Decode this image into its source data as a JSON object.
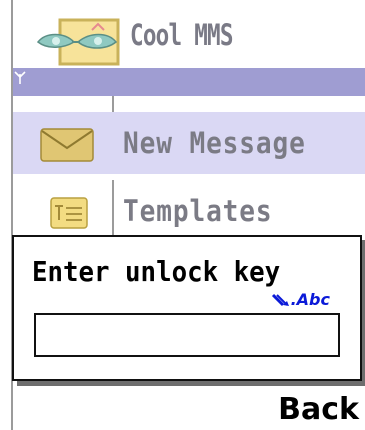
{
  "app": {
    "title": "Cool MMS",
    "icon": "app-logo-icon"
  },
  "status": {
    "signal_icon": "signal-antenna-icon"
  },
  "menu": {
    "items": [
      {
        "label": "New Message",
        "icon": "envelope-icon",
        "selected": true
      },
      {
        "label": "Templates",
        "icon": "template-icon",
        "selected": false
      }
    ]
  },
  "dialog": {
    "title": "Enter unlock key",
    "input_mode": ".Abc",
    "input_mode_icon": "pen-icon",
    "input_value": ""
  },
  "softkeys": {
    "right": "Back"
  },
  "colors": {
    "status_strip": "#9f9dd2",
    "selected_row": "#dad8f4",
    "menu_text": "#7b7b85",
    "input_mode": "#0b1ad8"
  }
}
